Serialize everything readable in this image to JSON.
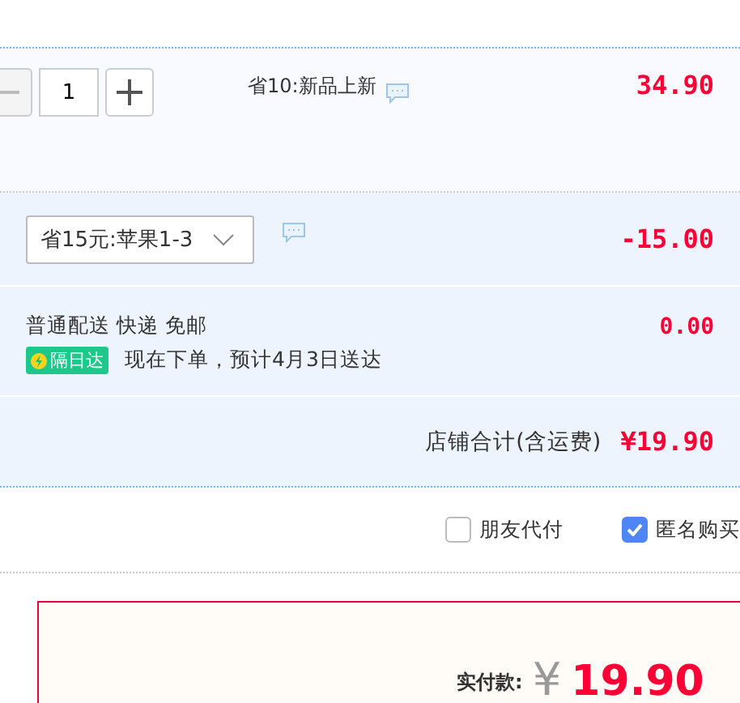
{
  "item": {
    "quantity": "1",
    "promo": "省10:新品上新",
    "price": "34.90"
  },
  "coupon": {
    "value": "省15元:苹果1-3",
    "amount": "-15.00"
  },
  "delivery": {
    "method": "普通配送 快递 免邮",
    "badge": "隔日达",
    "estimate": "现在下单，预计4月3日送达",
    "fee": "0.00"
  },
  "shop_total": {
    "label": "店铺合计(含运费)",
    "amount": "¥19.90"
  },
  "options": [
    {
      "label": "朋友代付",
      "checked": false
    },
    {
      "label": "匿名购买",
      "checked": true
    }
  ],
  "payment": {
    "label": "实付款:",
    "currency": "¥",
    "amount": "19.90"
  }
}
